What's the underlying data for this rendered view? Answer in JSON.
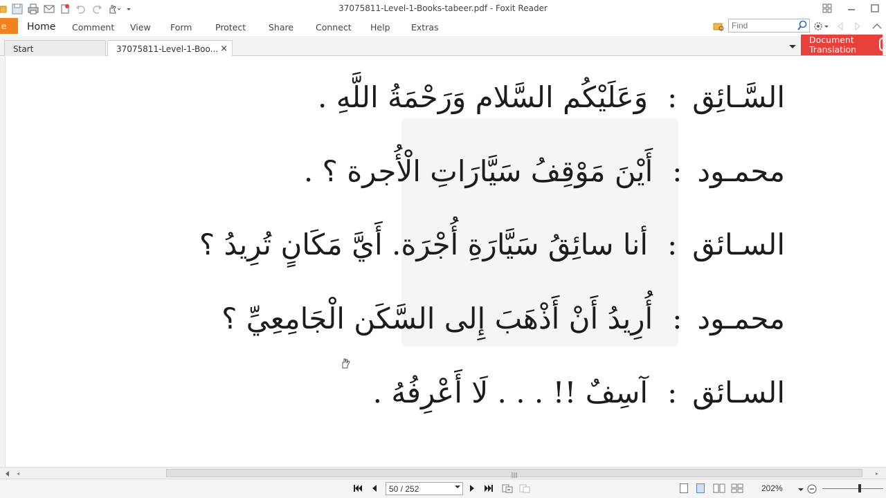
{
  "window": {
    "title": "37075811-Level-1-Books-tabeer.pdf - Foxit Reader",
    "controls": [
      "restore-icon",
      "minimize-icon",
      "maximize-icon"
    ]
  },
  "quick_access": [
    "open-icon",
    "save-icon",
    "print-icon",
    "email-icon",
    "new-icon",
    "undo-icon",
    "redo-icon",
    "hand-tool-icon",
    "customize-icon"
  ],
  "menu": {
    "file_label": "e",
    "items": [
      {
        "label": "Home",
        "active": true
      },
      {
        "label": "Comment"
      },
      {
        "label": "View"
      },
      {
        "label": "Form"
      },
      {
        "label": "Protect"
      },
      {
        "label": "Share"
      },
      {
        "label": "Connect"
      },
      {
        "label": "Help"
      },
      {
        "label": "Extras"
      }
    ],
    "find_placeholder": "Find"
  },
  "tabs": [
    {
      "label": "Start",
      "active": false
    },
    {
      "label": "37075811-Level-1-Boo...",
      "active": true,
      "close": "×"
    }
  ],
  "document_translation": {
    "line1": "Document",
    "line2": "Translation"
  },
  "document": {
    "lines": [
      {
        "speaker": "السَّـائِق",
        "colon": ":",
        "speech": "وَعَلَيْكُم السَّلام وَرَحْمَةُ اللَّهِ ."
      },
      {
        "speaker": "محمـود",
        "colon": ":",
        "speech": "أَيْنَ مَوْقِفُ سَيَّارَاتِ الْأُجرة ؟ ."
      },
      {
        "speaker": "السـائق",
        "colon": ":",
        "speech": "أنا سائِقُ سَيَّارَةِ أُجْرَة. أَيَّ مَكَانٍ تُرِيدُ ؟"
      },
      {
        "speaker": "محمـود",
        "colon": ":",
        "speech": "أُرِيدُ أَنْ أَذْهَبَ إِلى السَّكَن الْجَامِعِيِّ ؟"
      },
      {
        "speaker": "السـائق",
        "colon": ":",
        "speech": "آسِفٌ !! . . . لَا أَعْرِفُهُ ."
      }
    ]
  },
  "statusbar": {
    "page_display": "50 / 252",
    "zoom": "202%",
    "colors": {
      "accent": "#f0831e",
      "translation": "#e8413c"
    }
  }
}
